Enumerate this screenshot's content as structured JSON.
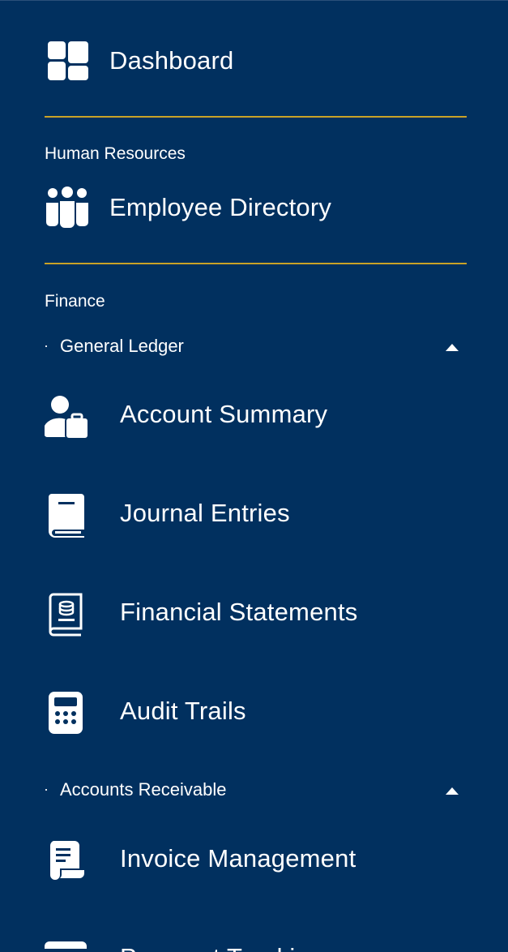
{
  "nav": {
    "dashboard": {
      "label": "Dashboard",
      "icon": "dashboard-icon"
    },
    "hr": {
      "title": "Human Resources",
      "employee_directory": {
        "label": "Employee Directory",
        "icon": "people-group-icon"
      }
    },
    "finance": {
      "title": "Finance",
      "general_ledger": {
        "bullet": "·",
        "label": "General Ledger",
        "expanded": true,
        "items": [
          {
            "label": "Account Summary",
            "icon": "user-briefcase-icon"
          },
          {
            "label": "Journal Entries",
            "icon": "book-icon"
          },
          {
            "label": "Financial Statements",
            "icon": "ledger-book-icon"
          },
          {
            "label": "Audit Trails",
            "icon": "calculator-icon"
          }
        ]
      },
      "accounts_receivable": {
        "bullet": "·",
        "label": "Accounts Receivable",
        "expanded": true,
        "items": [
          {
            "label": "Invoice Management",
            "icon": "invoice-icon"
          },
          {
            "label": "Payment Tracking",
            "icon": "payment-card-icon"
          }
        ]
      }
    }
  },
  "colors": {
    "background": "#01305f",
    "divider": "#c9a227",
    "text": "#ffffff"
  }
}
